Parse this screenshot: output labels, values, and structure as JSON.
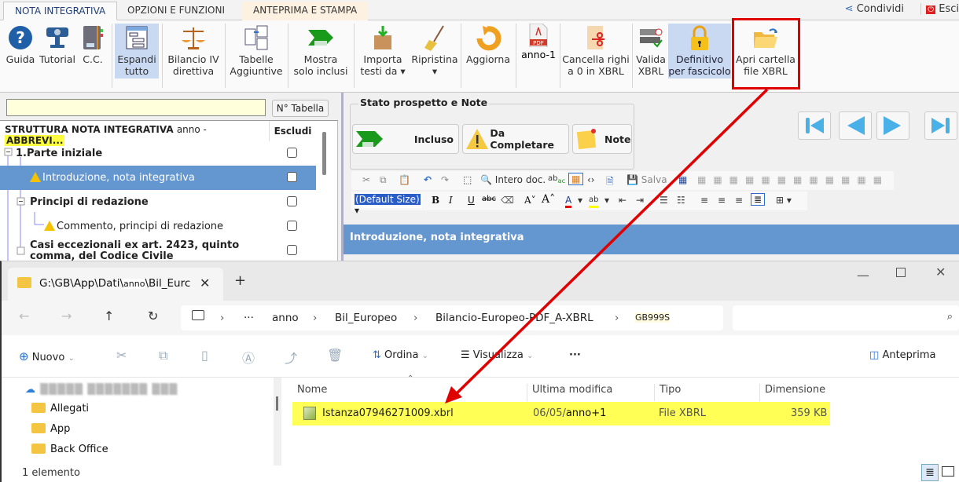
{
  "ribbon": {
    "tabs": [
      "NOTA INTEGRATIVA",
      "OPZIONI E FUNZIONI",
      "ANTEPRIMA E STAMPA"
    ],
    "share_label": "Condividi",
    "exit_label": "Esci",
    "buttons": [
      {
        "l1": "Guida",
        "l2": ""
      },
      {
        "l1": "Tutorial",
        "l2": ""
      },
      {
        "l1": "C.C.",
        "l2": ""
      },
      {
        "l1": "Espandi",
        "l2": "tutto"
      },
      {
        "l1": "Bilancio IV",
        "l2": "direttiva"
      },
      {
        "l1": "Tabelle",
        "l2": "Aggiuntive"
      },
      {
        "l1": "Mostra",
        "l2": "solo inclusi"
      },
      {
        "l1": "Importa",
        "l2": "testi da ▾"
      },
      {
        "l1": "Ripristina",
        "l2": "▾"
      },
      {
        "l1": "Aggiorna",
        "l2": ""
      },
      {
        "l1": "anno-1",
        "l2": ""
      },
      {
        "l1": "Cancella righi",
        "l2": "a 0 in XBRL"
      },
      {
        "l1": "Valida",
        "l2": "XBRL"
      },
      {
        "l1": "Definitivo",
        "l2": "per fascicolo"
      },
      {
        "l1": "Apri cartella",
        "l2": "file XBRL"
      }
    ]
  },
  "tree": {
    "search_value": "",
    "table_button": "N° Tabella",
    "header_prefix": "STRUTTURA NOTA INTEGRATIVA",
    "header_year": "anno -",
    "header_badge": "ABBREVI...",
    "exclude_header": "Escludi",
    "rows": [
      {
        "label": "1.Parte iniziale"
      },
      {
        "label": "Introduzione, nota integrativa"
      },
      {
        "label": "Principi di redazione"
      },
      {
        "label": "Commento, principi di redazione"
      },
      {
        "label": "Casi eccezionali ex art. 2423, quinto"
      },
      {
        "label": "comma, del Codice Civile"
      }
    ]
  },
  "status_panel": {
    "title": "Stato prospetto e Note",
    "incluso": "Incluso",
    "da_completare": "Da Completare",
    "note": "Note"
  },
  "editor": {
    "whole_doc": "Intero doc.",
    "save": "Salva",
    "font_size": "(Default Size)",
    "section_title": "Introduzione, nota integrativa"
  },
  "explorer": {
    "tab_title_a": "G:\\GB\\App\\Dati\\",
    "tab_title_b": "anno",
    "tab_title_c": "\\Bil_Eurc",
    "crumbs": [
      "anno",
      "Bil_Europeo",
      "Bilancio-Europeo-PDF_A-XBRL",
      "GB999S"
    ],
    "commands": {
      "new": "Nuovo",
      "sort": "Ordina",
      "view": "Visualizza",
      "preview": "Anteprima"
    },
    "nav": [
      "Allegati",
      "App",
      "Back Office"
    ],
    "columns": [
      "Nome",
      "Ultima modifica",
      "Tipo",
      "Dimensione"
    ],
    "file": {
      "name": "Istanza07946271009.xbrl",
      "date_a": "06/05/",
      "date_b": "anno+1",
      "type": "File XBRL",
      "size": "359 KB"
    },
    "status": "1 elemento"
  }
}
